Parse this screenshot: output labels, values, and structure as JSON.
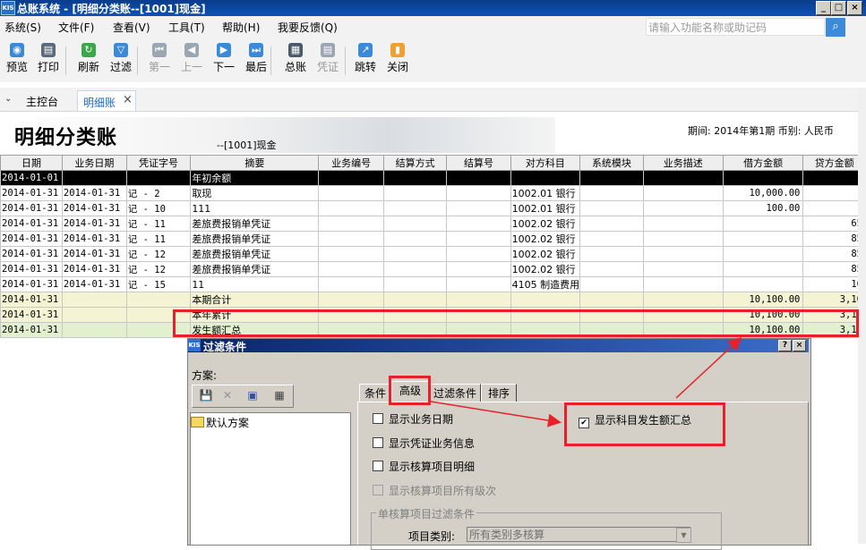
{
  "window": {
    "logo": "KIS",
    "title": "总账系统 - [明细分类账--[1001]现金]",
    "controls": [
      "_",
      "□",
      "×"
    ]
  },
  "menu": [
    "系统(S)",
    "文件(F)",
    "查看(V)",
    "工具(T)",
    "帮助(H)",
    "我要反馈(Q)"
  ],
  "search": {
    "placeholder": "请输入功能名称或助记码",
    "icon": "search-icon"
  },
  "toolbar": [
    {
      "label": "预览",
      "icon": "preview-icon",
      "color": "#3a8ad8",
      "enabled": true
    },
    {
      "label": "打印",
      "icon": "print-icon",
      "color": "#5a6a7a",
      "enabled": true
    },
    {
      "label": "刷新",
      "icon": "refresh-icon",
      "color": "#3aa84a",
      "enabled": true
    },
    {
      "label": "过滤",
      "icon": "filter-icon",
      "color": "#3a8ad8",
      "enabled": true
    },
    {
      "label": "第一",
      "icon": "first-icon",
      "color": "#9aa6b2",
      "enabled": false
    },
    {
      "label": "上一",
      "icon": "prev-icon",
      "color": "#9aa6b2",
      "enabled": false
    },
    {
      "label": "下一",
      "icon": "next-icon",
      "color": "#3a8ad8",
      "enabled": true
    },
    {
      "label": "最后",
      "icon": "last-icon",
      "color": "#3a8ad8",
      "enabled": true
    },
    {
      "label": "总账",
      "icon": "ledger-icon",
      "color": "#4a5a6a",
      "enabled": true
    },
    {
      "label": "凭证",
      "icon": "voucher-icon",
      "color": "#9aa6b2",
      "enabled": false
    },
    {
      "label": "跳转",
      "icon": "jump-icon",
      "color": "#3a8ad8",
      "enabled": true
    },
    {
      "label": "关闭",
      "icon": "close-icon",
      "color": "#f0a030",
      "enabled": true
    }
  ],
  "tabs": {
    "chevron": "⌄",
    "main": "主控台",
    "detail": "明细账",
    "close": "×"
  },
  "report": {
    "title": "明细分类账",
    "account": "--[1001]现金",
    "period": "期间: 2014年第1期   币别: 人民币"
  },
  "grid": {
    "headers": [
      "日期",
      "业务日期",
      "凭证字号",
      "摘要",
      "业务编号",
      "结算方式",
      "结算号",
      "对方科目",
      "系统模块",
      "业务描述",
      "借方金额",
      "贷方金额"
    ],
    "rows": [
      {
        "style": "sel",
        "cells": [
          "2014-01-01",
          "",
          "",
          "年初余额",
          "",
          "",
          "",
          "",
          "",
          "",
          "",
          ""
        ]
      },
      {
        "style": "",
        "cells": [
          "2014-01-31",
          "2014-01-31",
          "记 - 2",
          "取现",
          "",
          "",
          "",
          "1002.01 银行",
          "",
          "",
          "10,000.00",
          ""
        ]
      },
      {
        "style": "",
        "cells": [
          "2014-01-31",
          "2014-01-31",
          "记 - 10",
          "111",
          "",
          "",
          "",
          "1002.01 银行",
          "",
          "",
          "100.00",
          ""
        ]
      },
      {
        "style": "",
        "cells": [
          "2014-01-31",
          "2014-01-31",
          "记 - 11",
          "差旅费报销单凭证",
          "",
          "",
          "",
          "1002.02 银行",
          "",
          "",
          "",
          "65"
        ]
      },
      {
        "style": "",
        "cells": [
          "2014-01-31",
          "2014-01-31",
          "记 - 11",
          "差旅费报销单凭证",
          "",
          "",
          "",
          "1002.02 银行",
          "",
          "",
          "",
          "85"
        ]
      },
      {
        "style": "",
        "cells": [
          "2014-01-31",
          "2014-01-31",
          "记 - 12",
          "差旅费报销单凭证",
          "",
          "",
          "",
          "1002.02 银行",
          "",
          "",
          "",
          "85"
        ]
      },
      {
        "style": "",
        "cells": [
          "2014-01-31",
          "2014-01-31",
          "记 - 12",
          "差旅费报销单凭证",
          "",
          "",
          "",
          "1002.02 银行",
          "",
          "",
          "",
          "85"
        ]
      },
      {
        "style": "",
        "cells": [
          "2014-01-31",
          "2014-01-31",
          "记 - 15",
          "11",
          "",
          "",
          "",
          "4105 制造费用",
          "",
          "",
          "",
          "10"
        ]
      },
      {
        "style": "sum",
        "cells": [
          "2014-01-31",
          "",
          "",
          "本期合计",
          "",
          "",
          "",
          "",
          "",
          "",
          "10,100.00",
          "3,10"
        ]
      },
      {
        "style": "sum",
        "cells": [
          "2014-01-31",
          "",
          "",
          "本年累计",
          "",
          "",
          "",
          "",
          "",
          "",
          "10,100.00",
          "3,10"
        ]
      },
      {
        "style": "sum2",
        "cells": [
          "2014-01-31",
          "",
          "",
          "发生额汇总",
          "",
          "",
          "",
          "",
          "",
          "",
          "10,100.00",
          "3,10"
        ]
      }
    ]
  },
  "dialog": {
    "title": "过滤条件",
    "help": "?",
    "close": "×",
    "plan_label": "方案:",
    "plan_tools": [
      "💾",
      "✕",
      "▣",
      "▦"
    ],
    "plan_item": "默认方案",
    "tabs": [
      "条件",
      "高级",
      "过滤条件",
      "排序"
    ],
    "active_tab": "高级",
    "options": [
      {
        "label": "显示业务日期",
        "checked": false,
        "enabled": true
      },
      {
        "label": "显示凭证业务信息",
        "checked": false,
        "enabled": true
      },
      {
        "label": "显示核算项目明细",
        "checked": false,
        "enabled": true
      },
      {
        "label": "显示核算项目所有级次",
        "checked": false,
        "enabled": false
      }
    ],
    "summary_option": {
      "label": "显示科目发生额汇总",
      "checked": true
    },
    "group_title": "单核算项目过滤条件",
    "project_label": "项目类别:",
    "project_value": "所有类别多核算"
  },
  "colors": {
    "highlight_red": "#e8202a",
    "selected_row": "#000000",
    "sum_row": "#f4f4d4",
    "summary_row": "#e2f0d0"
  }
}
